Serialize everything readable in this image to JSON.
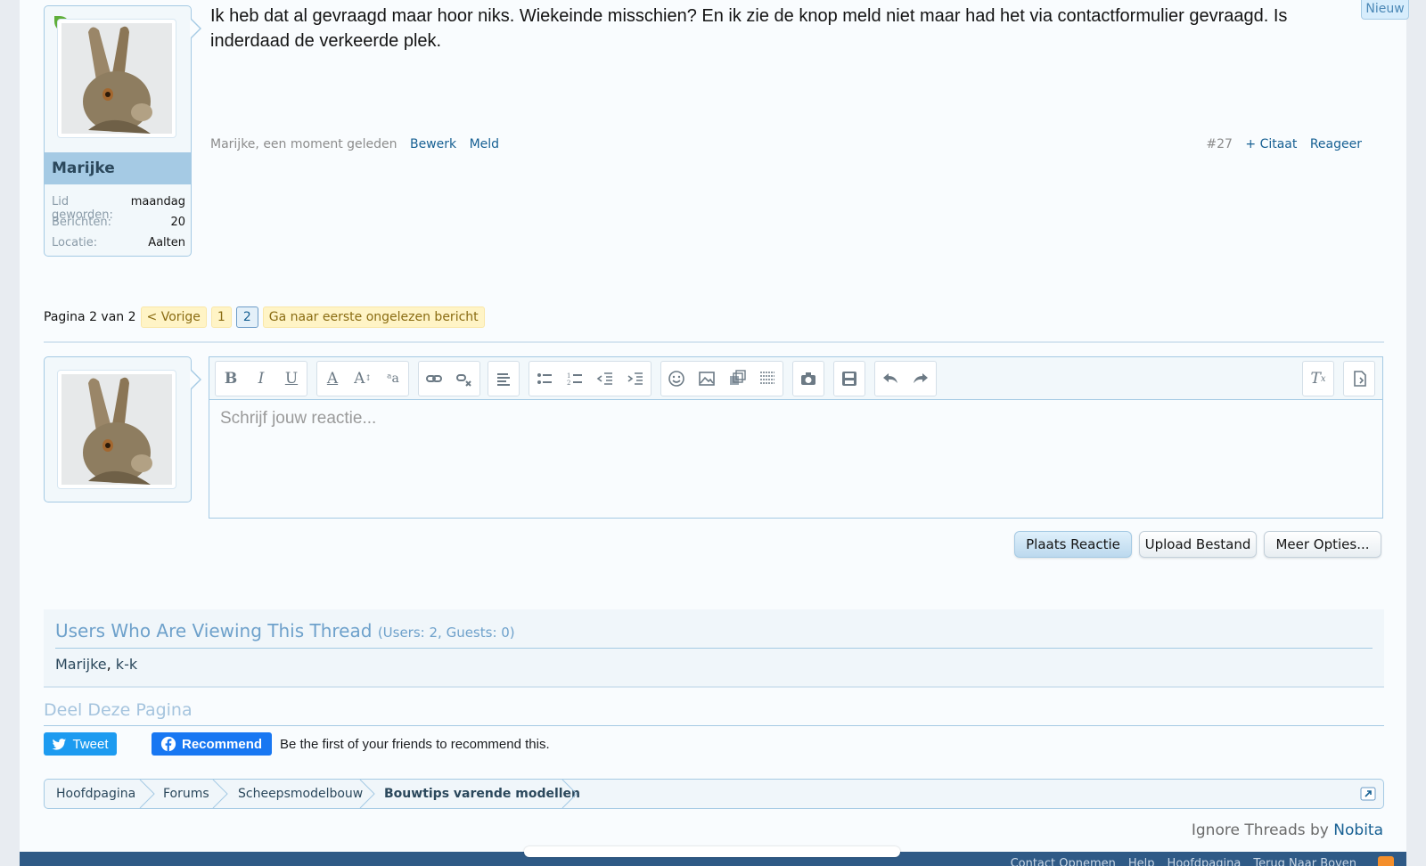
{
  "badge": {
    "new": "Nieuw"
  },
  "post": {
    "text": "Ik heb dat al gevraagd maar hoor niks. Wiekeinde misschien? En ik zie de knop meld niet maar had het via contactformulier gevraagd. Is inderdaad de verkeerde plek.",
    "author_time": "Marijke, een moment geleden",
    "edit": "Bewerk",
    "report": "Meld",
    "number": "#27",
    "quote": "+ Citaat",
    "reply": "Reageer"
  },
  "user": {
    "name": "Marijke",
    "stats": [
      {
        "label": "Lid geworden:",
        "value": "maandag"
      },
      {
        "label": "Berichten:",
        "value": "20"
      },
      {
        "label": "Locatie:",
        "value": "Aalten"
      }
    ]
  },
  "pagenav": {
    "info": "Pagina 2 van 2",
    "prev": "< Vorige",
    "pages": [
      "1",
      "2"
    ],
    "current_page": "2",
    "first_unread": "Ga naar eerste ongelezen bericht"
  },
  "editor": {
    "placeholder": "Schrijf jouw reactie...",
    "toolbar_icons": [
      "bold-icon",
      "italic-icon",
      "underline-icon",
      "text-color-icon",
      "font-size-icon",
      "font-family-icon",
      "link-icon",
      "unlink-icon",
      "align-left-icon",
      "bullet-list-icon",
      "numbered-list-icon",
      "outdent-icon",
      "indent-icon",
      "smiley-icon",
      "image-icon",
      "media-icon",
      "more-icon",
      "camera-icon",
      "save-draft-icon",
      "undo-icon",
      "redo-icon",
      "remove-format-icon",
      "toggle-bbcode-icon"
    ]
  },
  "buttons": {
    "post_reply": "Plaats Reactie",
    "upload": "Upload Bestand",
    "more_options": "Meer Opties..."
  },
  "viewers": {
    "title": "Users Who Are Viewing This Thread",
    "counts": "(Users: 2, Guests: 0)",
    "users": [
      "Marijke",
      "k-k"
    ]
  },
  "share": {
    "title": "Deel Deze Pagina",
    "tweet": "Tweet",
    "recommend": "Recommend",
    "fb_text": "Be the first of your friends to recommend this."
  },
  "breadcrumb": [
    "Hoofdpagina",
    "Forums",
    "Scheepsmodelbouw",
    "Bouwtips varende modellen"
  ],
  "ignore": {
    "prefix": "Ignore Threads by",
    "link": "Nobita"
  },
  "footer": {
    "links": [
      "Contact Opnemen",
      "Help",
      "Hoofdpagina",
      "Terug Naar Boven"
    ]
  },
  "colors": {
    "accent": "#176093",
    "border": "#a5cae4",
    "pagenav_bg": "#fff4c6",
    "footer": "#2f5a86"
  }
}
